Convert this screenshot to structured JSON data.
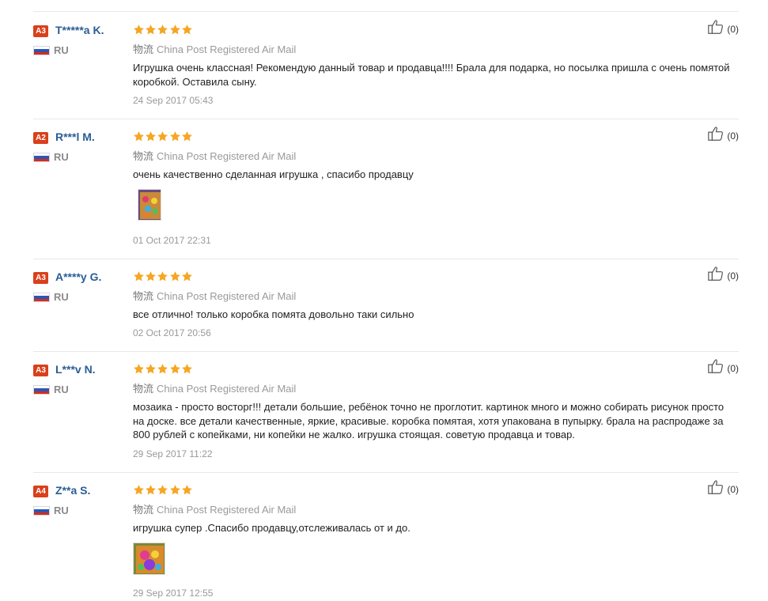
{
  "reviews": [
    {
      "level": "A3",
      "user": "T*****a K.",
      "country": "RU",
      "shipping_cn": "物流",
      "shipping": "China Post Registered Air Mail",
      "text": "Игрушка очень классная! Рекомендую данный товар и продавца!!!! Брала для подарка, но посылка пришла с очень помятой коробкой. Оставила сыну.",
      "date": "24 Sep 2017 05:43",
      "likes": "(0)",
      "has_photo": false
    },
    {
      "level": "A2",
      "user": "R***l M.",
      "country": "RU",
      "shipping_cn": "物流",
      "shipping": "China Post Registered Air Mail",
      "text": "очень качественно сделанная игрушка , спасибо продавцу",
      "date": "01 Oct 2017 22:31",
      "likes": "(0)",
      "has_photo": true
    },
    {
      "level": "A3",
      "user": "A****y G.",
      "country": "RU",
      "shipping_cn": "物流",
      "shipping": "China Post Registered Air Mail",
      "text": "все отлично! только коробка помята довольно таки сильно",
      "date": "02 Oct 2017 20:56",
      "likes": "(0)",
      "has_photo": false
    },
    {
      "level": "A3",
      "user": "L***v N.",
      "country": "RU",
      "shipping_cn": "物流",
      "shipping": "China Post Registered Air Mail",
      "text": "мозаика - просто восторг!!! детали большие, ребёнок точно не проглотит. картинок много и можно собирать рисунок просто на доске. все детали качественные, яркие, красивые. коробка помятая, хотя упакована в пупырку. брала на распродаже за 800 рублей с копейками, ни копейки не жалко. игрушка стоящая. советую продавца и товар.",
      "date": "29 Sep 2017 11:22",
      "likes": "(0)",
      "has_photo": false
    },
    {
      "level": "A4",
      "user": "Z**a S.",
      "country": "RU",
      "shipping_cn": "物流",
      "shipping": "China Post Registered Air Mail",
      "text": "игрушка супер .Спасибо продавцу,отслеживалась от и до.",
      "date": "29 Sep 2017 12:55",
      "likes": "(0)",
      "has_photo": true
    }
  ],
  "colors": {
    "level_badge": "#d9401b",
    "username": "#2a5d96",
    "star": "#f5a623",
    "divider": "#e8e8e8"
  }
}
